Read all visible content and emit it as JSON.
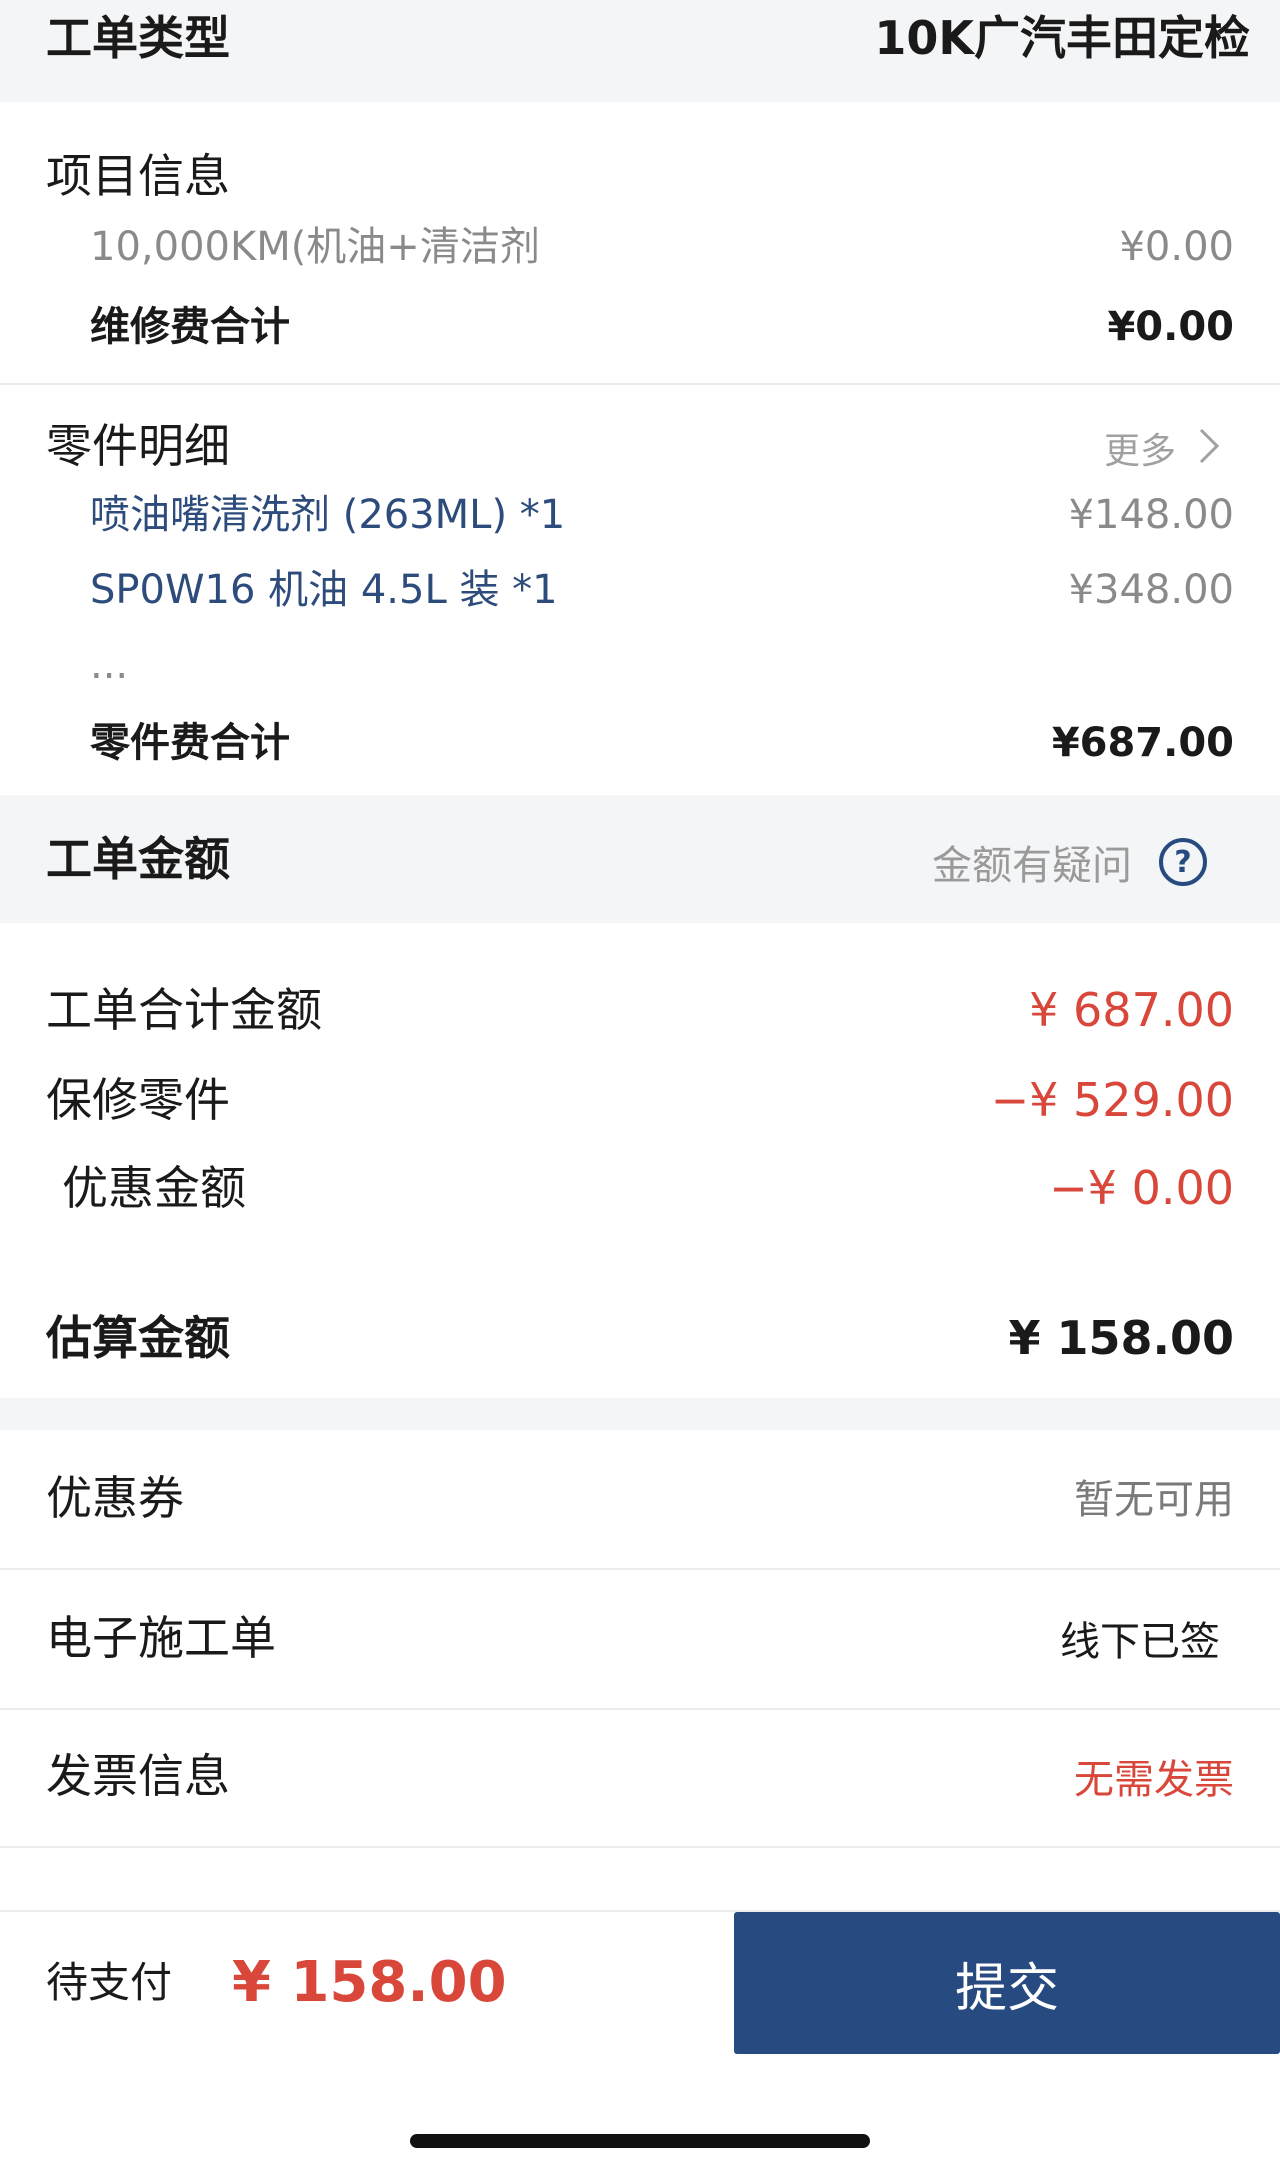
{
  "header": {
    "label": "工单类型",
    "value": "10K广汽丰田定检"
  },
  "project": {
    "title": "项目信息",
    "items": [
      {
        "name": "10,000KM(机油+清洁剂",
        "price": "¥0.00"
      }
    ],
    "subtotal_label": "维修费合计",
    "subtotal_value": "¥0.00"
  },
  "parts": {
    "title": "零件明细",
    "more_label": "更多",
    "items": [
      {
        "name": "喷油嘴清洗剂 (263ML) *1",
        "price": "¥148.00"
      },
      {
        "name": "SP0W16 机油 4.5L 装 *1",
        "price": "¥348.00"
      }
    ],
    "ellipsis": "...",
    "subtotal_label": "零件费合计",
    "subtotal_value": "¥687.00"
  },
  "amount": {
    "title": "工单金额",
    "question_label": "金额有疑问",
    "rows": [
      {
        "label": "工单合计金额",
        "value": "¥ 687.00"
      },
      {
        "label": "保修零件",
        "value": "−¥ 529.00"
      },
      {
        "label": "优惠金额",
        "value": "−¥ 0.00"
      }
    ],
    "estimate_label": "估算金额",
    "estimate_value": "¥ 158.00"
  },
  "options": [
    {
      "label": "优惠券",
      "value": "暂无可用"
    },
    {
      "label": "电子施工单",
      "value": "线下已签"
    },
    {
      "label": "发票信息",
      "value": "无需发票"
    }
  ],
  "footer": {
    "pending_label": "待支付",
    "pending_value": "¥ 158.00",
    "submit_label": "提交"
  },
  "colors": {
    "accent_blue": "#274b80",
    "text_blue": "#2d4c7c",
    "red": "#d9463a",
    "band_gray": "#f4f5f7"
  }
}
